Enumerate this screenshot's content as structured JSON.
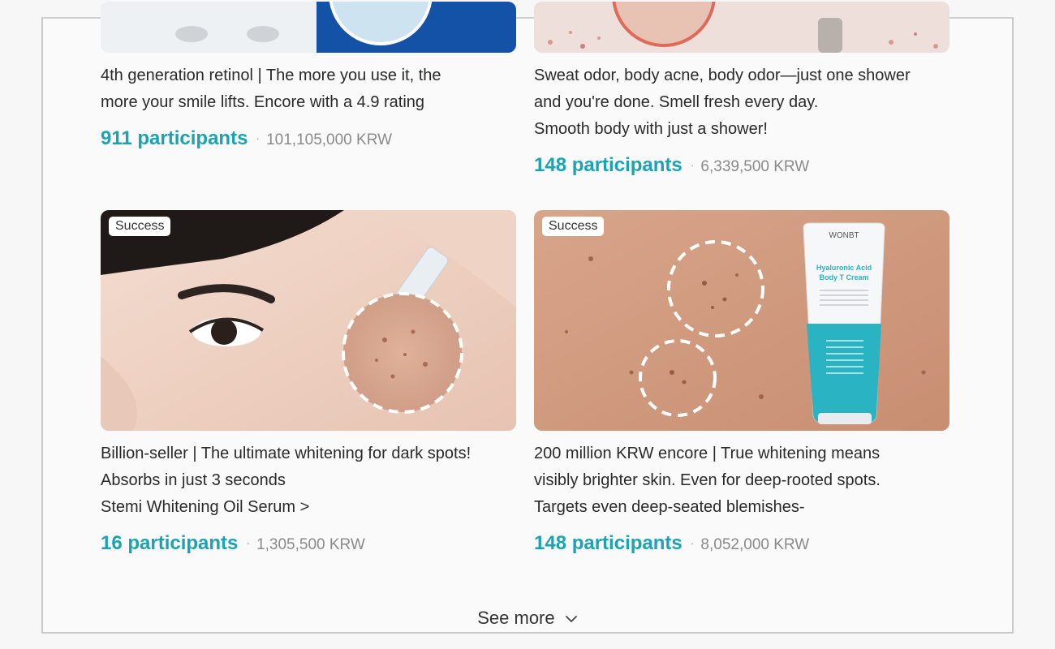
{
  "cards": [
    {
      "title_lines": [
        "4th generation retinol | The more you use it, the",
        "more your smile lifts. Encore with a 4.9 rating"
      ],
      "participants": "911 participants",
      "separator": "·",
      "amount": "101,105,000 KRW"
    },
    {
      "title_lines": [
        "Sweat odor, body acne, body odor—just one shower",
        "and you're done. Smell fresh every day.",
        "Smooth body with just a shower!"
      ],
      "participants": "148 participants",
      "separator": "·",
      "amount": "6,339,500 KRW"
    },
    {
      "badge": "Success",
      "title_lines": [
        "Billion-seller | The ultimate whitening for dark spots!",
        "Absorbs in just 3 seconds",
        "Stemi Whitening Oil Serum >"
      ],
      "participants": "16 participants",
      "separator": "·",
      "amount": "1,305,500 KRW"
    },
    {
      "badge": "Success",
      "title_lines": [
        "200 million KRW encore | True whitening means",
        "visibly brighter skin. Even for deep-rooted spots.",
        "Targets even deep-seated blemishes-"
      ],
      "participants": "148 participants",
      "separator": "·",
      "amount": "8,052,000 KRW",
      "product_label": {
        "brand": "WONBT",
        "name_line1": "Hyaluronic Acid",
        "name_line2": "Body T Cream"
      }
    }
  ],
  "see_more": {
    "label": "See more",
    "icon": "chevron-down-icon"
  },
  "colors": {
    "accent": "#1aa3b3",
    "amount": "#8a8a8a",
    "text": "#2a2a2a"
  }
}
